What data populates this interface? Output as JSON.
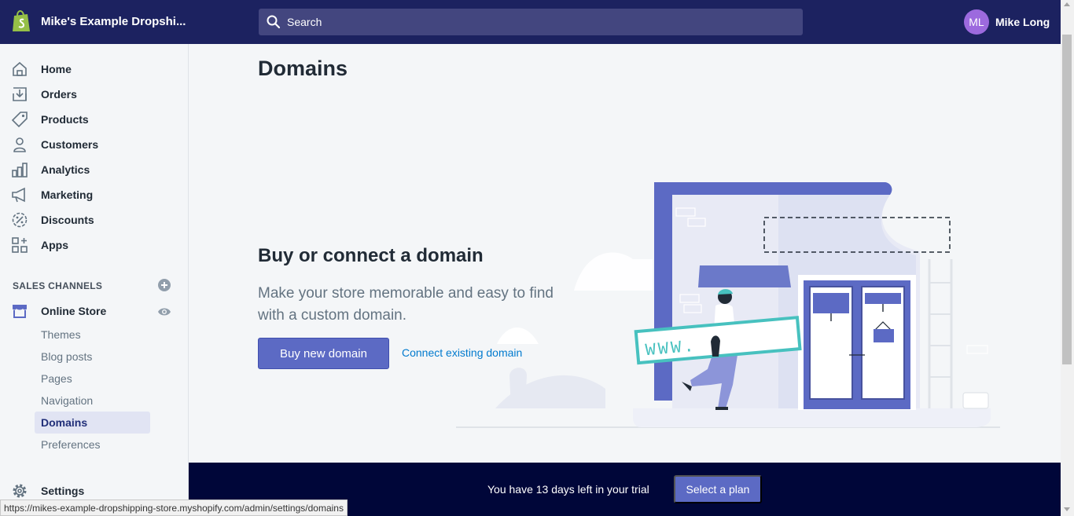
{
  "topbar": {
    "store_name": "Mike's Example Dropshi...",
    "store_logo_icon": "shopify-bag-icon",
    "search_placeholder": "Search",
    "user_initials": "ML",
    "user_name": "Mike Long",
    "bg_color": "#1c2260"
  },
  "sidebar": {
    "items": [
      {
        "label": "Home",
        "icon": "home-icon"
      },
      {
        "label": "Orders",
        "icon": "orders-icon"
      },
      {
        "label": "Products",
        "icon": "tag-icon"
      },
      {
        "label": "Customers",
        "icon": "customer-icon"
      },
      {
        "label": "Analytics",
        "icon": "analytics-icon"
      },
      {
        "label": "Marketing",
        "icon": "megaphone-icon"
      },
      {
        "label": "Discounts",
        "icon": "discount-icon"
      },
      {
        "label": "Apps",
        "icon": "apps-icon"
      }
    ],
    "channels_title": "SALES CHANNELS",
    "online_store": "Online Store",
    "sub_items": [
      "Themes",
      "Blog posts",
      "Pages",
      "Navigation",
      "Domains",
      "Preferences"
    ],
    "active_sub_item": "Domains",
    "settings": "Settings"
  },
  "main": {
    "title": "Domains",
    "empty_heading": "Buy or connect a domain",
    "empty_body": "Make your store memorable and easy to find with a custom domain.",
    "primary_button": "Buy new domain",
    "secondary_link": "Connect existing domain",
    "illustration_sign_text": "WWW.",
    "accent_color": "#5c6ac4"
  },
  "trial": {
    "text": "You have 13 days left in your trial",
    "button": "Select a plan"
  },
  "status_bar": {
    "url": "https://mikes-example-dropshipping-store.myshopify.com/admin/settings/domains"
  }
}
